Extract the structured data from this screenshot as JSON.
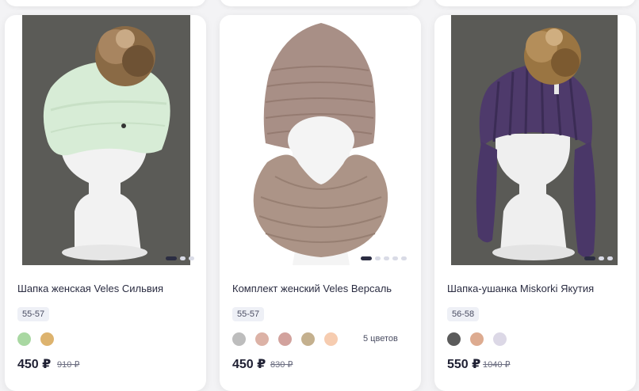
{
  "products": [
    {
      "name": "Шапка женская Veles Сильвия",
      "size": "55-57",
      "swatches": [
        "#a9d8a2",
        "#ddb36e"
      ],
      "price": "450 ₽",
      "old_price": "910 ₽",
      "colors_count": ""
    },
    {
      "name": "Комплект женский Veles Версаль",
      "size": "55-57",
      "swatches": [
        "#bdbdbd",
        "#dcb2a6",
        "#d2a29d",
        "#c4b08e",
        "#f6ccb0"
      ],
      "price": "450 ₽",
      "old_price": "830 ₽",
      "colors_count": "5 цветов"
    },
    {
      "name": "Шапка-ушанка Miskorki Якутия",
      "size": "56-58",
      "swatches": [
        "#5b5b5b",
        "#ddab90",
        "#dcd8e6"
      ],
      "price": "550 ₽",
      "old_price": "1040 ₽",
      "colors_count": ""
    }
  ],
  "accent_color": "#2b2d42"
}
